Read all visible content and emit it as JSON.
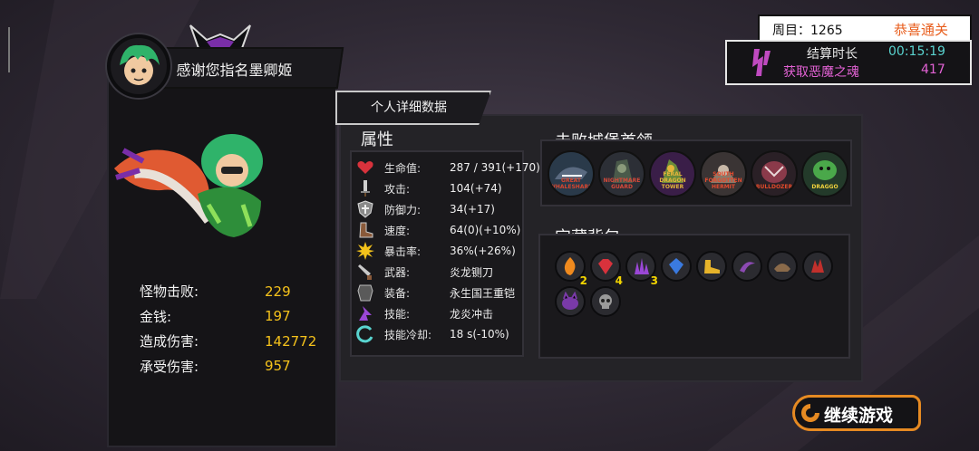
{
  "player": {
    "name": "感谢您指名墨卿姬"
  },
  "stats": [
    {
      "label": "怪物击败:",
      "value": "229"
    },
    {
      "label": "金钱:",
      "value": "197"
    },
    {
      "label": "造成伤害:",
      "value": "142772"
    },
    {
      "label": "承受伤害:",
      "value": "957"
    }
  ],
  "tab": {
    "label": "个人详细数据"
  },
  "attributes": {
    "title": "属性",
    "rows": [
      {
        "icon": "heart-icon",
        "label": "生命值:",
        "value": "287 / 391(+170)"
      },
      {
        "icon": "sword-icon",
        "label": "攻击:",
        "value": "104(+74)"
      },
      {
        "icon": "shield-icon",
        "label": "防御力:",
        "value": "34(+17)"
      },
      {
        "icon": "boot-icon",
        "label": "速度:",
        "value": "64(0)(+10%)"
      },
      {
        "icon": "crit-burst-icon",
        "label": "暴击率:",
        "value": "36%(+26%)"
      },
      {
        "icon": "weapon-icon",
        "label": "武器:",
        "value": "炎龙铡刀"
      },
      {
        "icon": "armor-icon",
        "label": "装备:",
        "value": "永生国王重铠"
      },
      {
        "icon": "skill-icon",
        "label": "技能:",
        "value": "龙炎冲击"
      },
      {
        "icon": "cooldown-icon",
        "label": "技能冷却:",
        "value": "18 s(-10%)"
      }
    ]
  },
  "bosses": {
    "title": "击败城堡首领",
    "items": [
      {
        "name": "GREAT WHALESHARK",
        "color": "#d6462f"
      },
      {
        "name": "NIGHTMARE GUARD",
        "color": "#d84a3a"
      },
      {
        "name": "FERAL DRAGON TOWER",
        "color": "#e4b43a"
      },
      {
        "name": "SOUTH FORGOTTEN HERMIT",
        "color": "#e34b2f"
      },
      {
        "name": "BULLDOZER",
        "color": "#e24a2a"
      },
      {
        "name": "DRAGGO",
        "color": "#f1d23c"
      }
    ]
  },
  "treasure": {
    "title": "宝藏背包",
    "items": [
      {
        "icon": "fire-gem-icon",
        "color": "#f08a1e",
        "count": "2"
      },
      {
        "icon": "ruby-icon",
        "color": "#d8323c",
        "count": "4"
      },
      {
        "icon": "amethyst-crystal-icon",
        "color": "#9a47d6",
        "count": "3"
      },
      {
        "icon": "sapphire-icon",
        "color": "#3a7ae0",
        "count": ""
      },
      {
        "icon": "golden-boot-icon",
        "color": "#e6b32a",
        "count": ""
      },
      {
        "icon": "purple-horn-icon",
        "color": "#8c4ab3",
        "count": ""
      },
      {
        "icon": "bronze-helmet-icon",
        "color": "#8a6a4a",
        "count": ""
      },
      {
        "icon": "red-claw-icon",
        "color": "#c2302c",
        "count": ""
      },
      {
        "icon": "purple-beast-icon",
        "color": "#7a3aa8",
        "count": ""
      },
      {
        "icon": "skull-crest-icon",
        "color": "#9a9a9a",
        "count": ""
      }
    ]
  },
  "run": {
    "cycle": "周目：1265",
    "clear": "恭喜通关",
    "time_label": "结算时长",
    "time_value": "00:15:19",
    "souls_label": "获取恶魔之魂",
    "souls_value": "417"
  },
  "actions": {
    "continue": "继续游戏"
  },
  "colors": {
    "accent_orange": "#e68a22",
    "stat_yellow": "#f5c21b",
    "time_cyan": "#59d3cf",
    "soul_pink": "#e262d4"
  }
}
